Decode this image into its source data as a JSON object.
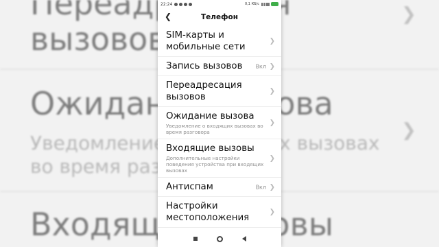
{
  "backdrop": {
    "lines": [
      "Переадресация",
      "вызовов",
      "Ожидание вызова",
      "Уведомление о входящих вызовах",
      "во время разговора",
      "Входящие вызовы"
    ]
  },
  "status_bar": {
    "time": "22:24",
    "net_speed": "0,1 КБ/с"
  },
  "header": {
    "title": "Телефон"
  },
  "settings": [
    {
      "label": "SIM-карты и мобильные сети",
      "description": "",
      "value": ""
    },
    {
      "label": "Запись вызовов",
      "description": "",
      "value": "Вкл"
    },
    {
      "label": "Переадресация вызовов",
      "description": "",
      "value": ""
    },
    {
      "label": "Ожидание вызова",
      "description": "Уведомление о входящих вызовах во время разговора",
      "value": ""
    },
    {
      "label": "Входящие вызовы",
      "description": "Дополнительные настройки поведения устройства при входящих вызовах",
      "value": ""
    },
    {
      "label": "Антиспам",
      "description": "",
      "value": "Вкл"
    },
    {
      "label": "Настройки местоположения",
      "description": "",
      "value": ""
    }
  ]
}
